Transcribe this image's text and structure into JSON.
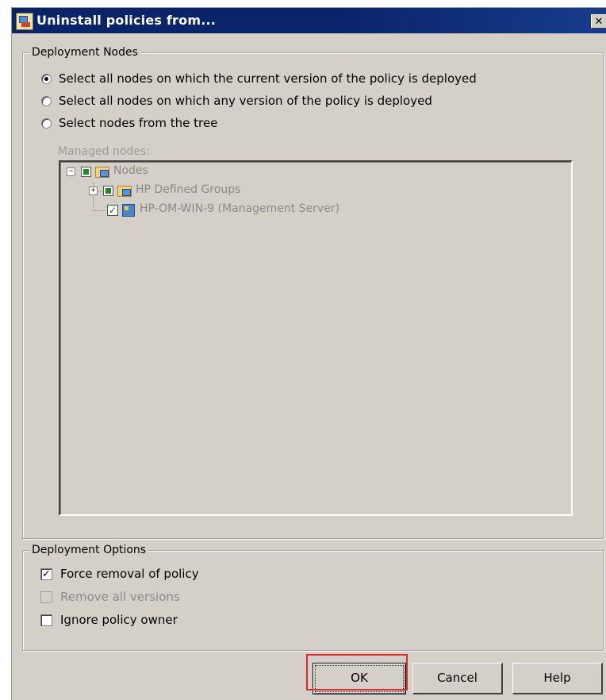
{
  "window": {
    "title": "Uninstall policies from...",
    "close_glyph": "✕"
  },
  "deployment_nodes": {
    "legend": "Deployment Nodes",
    "radios": [
      {
        "label": "Select all nodes on which the current version of the policy is deployed",
        "checked": true
      },
      {
        "label": "Select all nodes on which any version of the policy is deployed",
        "checked": false
      },
      {
        "label": "Select nodes from the tree",
        "checked": false
      }
    ],
    "managed_nodes_label": "Managed nodes:",
    "tree": {
      "root": {
        "label": "Nodes",
        "expander": "−"
      },
      "children": [
        {
          "label": "HP Defined Groups",
          "expander": "+"
        },
        {
          "label": "HP-OM-WIN-9 (Management Server)",
          "check": "✓"
        }
      ]
    }
  },
  "deployment_options": {
    "legend": "Deployment Options",
    "options": [
      {
        "label": "Force removal of policy",
        "checked": true,
        "enabled": true,
        "mark": "✓"
      },
      {
        "label": "Remove all versions",
        "checked": false,
        "enabled": false
      },
      {
        "label": "Ignore policy owner",
        "checked": false,
        "enabled": true
      }
    ]
  },
  "buttons": {
    "ok": "OK",
    "cancel": "Cancel",
    "help": "Help"
  },
  "colors": {
    "dialog_bg": "#d4d0c8",
    "titlebar": "#0a246a",
    "highlight": "#e0262b"
  }
}
